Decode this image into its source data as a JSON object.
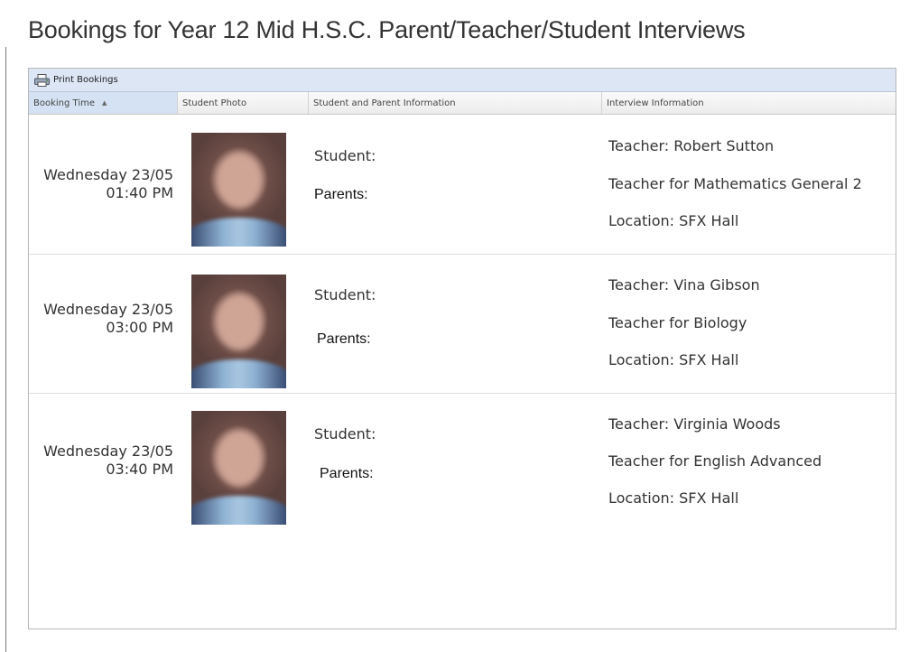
{
  "page": {
    "title": "Bookings for Year 12 Mid H.S.C. Parent/Teacher/Student Interviews"
  },
  "toolbar": {
    "print_label": "Print Bookings",
    "print_icon": "printer-icon"
  },
  "columns": [
    {
      "label": "Booking Time",
      "sort_indicator": "▲"
    },
    {
      "label": "Student Photo"
    },
    {
      "label": "Student and Parent Information"
    },
    {
      "label": "Interview Information"
    }
  ],
  "bookings": [
    {
      "day": "Wednesday 23/05",
      "time": "01:40 PM",
      "student_label": "Student:",
      "parents_label": "Parents:",
      "teacher": "Teacher: Robert Sutton",
      "subject": "Teacher for Mathematics General 2",
      "location": "Location: SFX Hall"
    },
    {
      "day": "Wednesday 23/05",
      "time": "03:00 PM",
      "student_label": "Student:",
      "parents_label": "Parents:",
      "teacher": "Teacher: Vina Gibson",
      "subject": "Teacher for Biology",
      "location": "Location: SFX Hall"
    },
    {
      "day": "Wednesday 23/05",
      "time": "03:40 PM",
      "student_label": "Student:",
      "parents_label": "Parents:",
      "teacher": "Teacher: Virginia Woods",
      "subject": "Teacher for English Advanced",
      "location": "Location: SFX Hall"
    }
  ]
}
